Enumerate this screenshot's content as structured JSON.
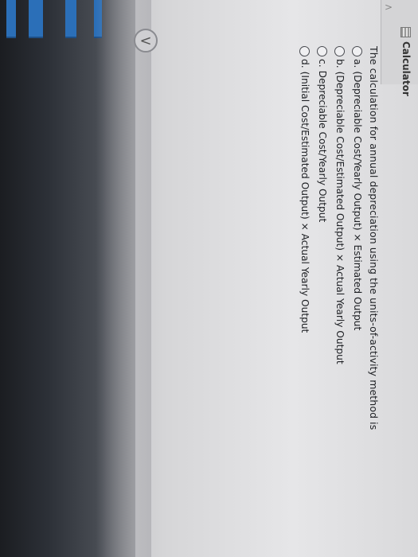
{
  "header": {
    "tool_label": "Calculator",
    "collapse_arrow": ">",
    "back_arrow": "<"
  },
  "question": {
    "text": "The calculation for annual depreciation using the units-of-activity method is",
    "options": [
      {
        "letter": "a.",
        "label": "(Depreciable Cost/Yearly Output) × Estimated Output"
      },
      {
        "letter": "b.",
        "label": "(Depreciable Cost/Estimated Output) × Actual Yearly Output"
      },
      {
        "letter": "c.",
        "label": "Depreciable Cost/Yearly Output"
      },
      {
        "letter": "d.",
        "label": "(Initial Cost/Estimated Output) × Actual Yearly Output"
      }
    ]
  },
  "icons": {
    "calculator": "calculator-icon",
    "back": "chevron-left-icon",
    "radio": "radio-unselected"
  },
  "colors": {
    "accent_blue": "#2b6fb8",
    "text": "#1e2024"
  }
}
